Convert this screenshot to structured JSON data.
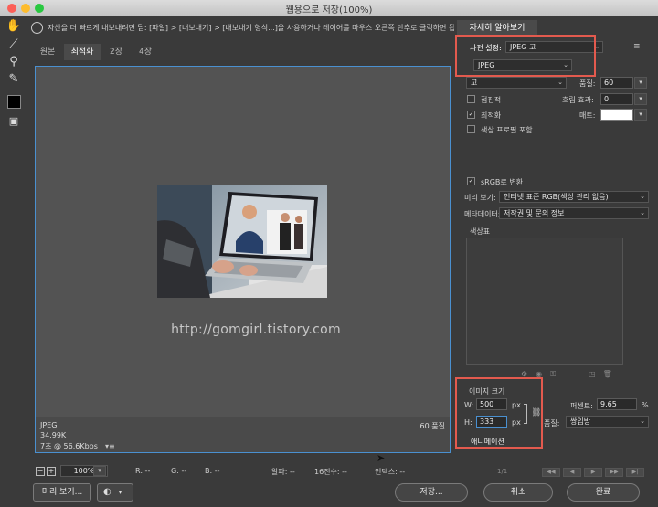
{
  "window": {
    "title": "웹용으로 저장(100%)"
  },
  "info_bar": {
    "text": "자산을 더 빠르게 내보내려면 팁: [파일] > [내보내기] > [내보내기 형식...]을 사용하거나 레이어를 마우스 오른쪽 단추로 클릭하면 됩니다."
  },
  "tabs": [
    {
      "label": "원본"
    },
    {
      "label": "최적화"
    },
    {
      "label": "2장"
    },
    {
      "label": "4장"
    }
  ],
  "canvas": {
    "watermark": "http://gomgirl.tistory.com",
    "format": "JPEG",
    "size": "34.99K",
    "time": "7초 @ 56.6Kbps",
    "quality_label": "60 품질"
  },
  "status_bar": {
    "zoom": "100%",
    "r": "R: --",
    "g": "G: --",
    "b": "B: --",
    "alpha": "알파: --",
    "hex": "16진수: --",
    "index": "인덱스: --"
  },
  "buttons": {
    "preview": "미리 보기...",
    "save": "저장...",
    "cancel": "취소",
    "done": "완료"
  },
  "right_panel": {
    "learn_more": "자세히 알아보기",
    "preset_label": "사전 설정:",
    "preset_value": "JPEG 고",
    "format_value": "JPEG",
    "quality_level": "고",
    "quality_label": "품질:",
    "quality_value": "60",
    "progressive_label": "점진적",
    "blur_label": "흐림 효과:",
    "blur_value": "0",
    "optimized_label": "최적화",
    "matte_label": "매트:",
    "embed_profile_label": "색상 프로필 포함",
    "srgb_label": "sRGB로 변환",
    "preview_label": "미리 보기:",
    "preview_value": "인터넷 표준 RGB(색상 관리 없음)",
    "metadata_label": "메타데이터:",
    "metadata_value": "저작권 및 문의 정보",
    "color_table_label": "색상표",
    "image_size_label": "이미지 크기",
    "w_label": "W:",
    "w_value": "500",
    "h_label": "H:",
    "h_value": "333",
    "px_unit": "px",
    "percent_label": "퍼센트:",
    "percent_value": "9.65",
    "percent_unit": "%",
    "quality2_label": "품질:",
    "quality2_value": "쌍입방",
    "animation_label": "애니메이션",
    "page_indicator": "1/1"
  },
  "colors": {
    "accent_red": "#e35a4e",
    "selection_blue": "#4a90d0"
  }
}
